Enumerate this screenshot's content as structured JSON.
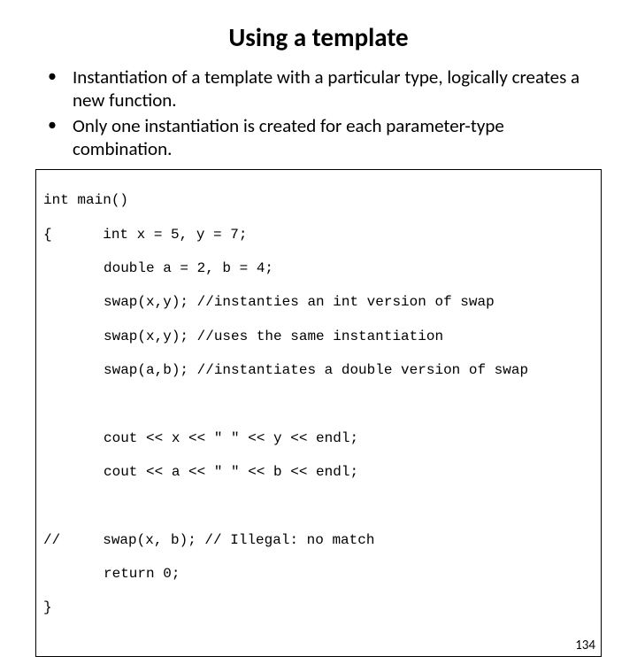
{
  "title": "Using a template",
  "bullets": [
    "Instantiation of a template with a particular type, logically creates a new function.",
    "Only one instantiation is created for each parameter-type combination."
  ],
  "code": {
    "l0": "int main()",
    "l1": "{      int x = 5, y = 7;",
    "l2": "double a = 2, b = 4;",
    "l3": "swap(x,y); //instanties an int version of swap",
    "l4": "swap(x,y); //uses the same instantiation",
    "l5": "swap(a,b); //instantiates a double version of swap",
    "l6": "cout << x << \" \" << y << endl;",
    "l7": "cout << a << \" \" << b << endl;",
    "l8": "//     swap(x, b); // Illegal: no match",
    "l9": "return 0;",
    "l10": "}"
  },
  "pagenum": "134"
}
